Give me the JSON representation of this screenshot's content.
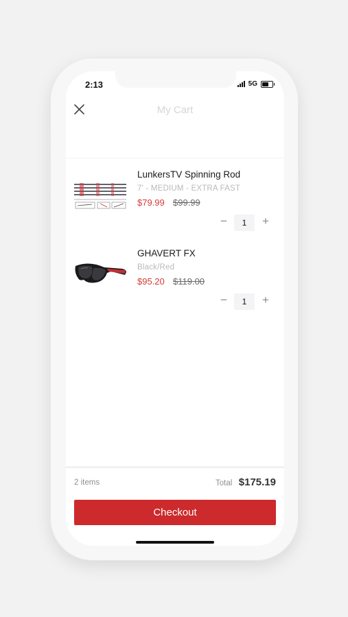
{
  "status_bar": {
    "time": "2:13",
    "network": "5G",
    "battery_level": 0.65
  },
  "header": {
    "title": "My Cart",
    "close_icon": "close-icon"
  },
  "cart": {
    "items": [
      {
        "name": "LunkersTV Spinning Rod",
        "variant": "7' - MEDIUM - EXTRA FAST",
        "price": "$79.99",
        "original_price": "$99.99",
        "quantity": "1",
        "minus_label": "−",
        "plus_label": "+"
      },
      {
        "name": "GHAVERT FX",
        "variant": "Black/Red",
        "price": "$95.20",
        "original_price": "$119.00",
        "quantity": "1",
        "minus_label": "−",
        "plus_label": "+"
      }
    ]
  },
  "summary": {
    "item_count": "2 items",
    "total_label": "Total",
    "total_value": "$175.19",
    "checkout_label": "Checkout"
  },
  "colors": {
    "accent": "#cc2a2d",
    "sale_price": "#d63a38"
  }
}
